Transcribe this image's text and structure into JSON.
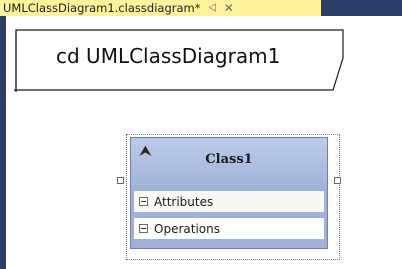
{
  "tab": {
    "title": "UMLClassDiagram1.classdiagram*",
    "pin_glyph": "⨞",
    "close_glyph": "✕",
    "active_color": "#fff29d"
  },
  "frame": {
    "title": "cd UMLClassDiagram1",
    "chrome_color": "#2b3e67"
  },
  "class_shape": {
    "name": "Class1",
    "collapse_glyph": "«",
    "compartments": [
      {
        "label": "Attributes",
        "expand_glyph": "minus"
      },
      {
        "label": "Operations",
        "expand_glyph": "minus"
      }
    ],
    "fill_color": "#9fb1d6",
    "header_color": "#bccbe7"
  }
}
